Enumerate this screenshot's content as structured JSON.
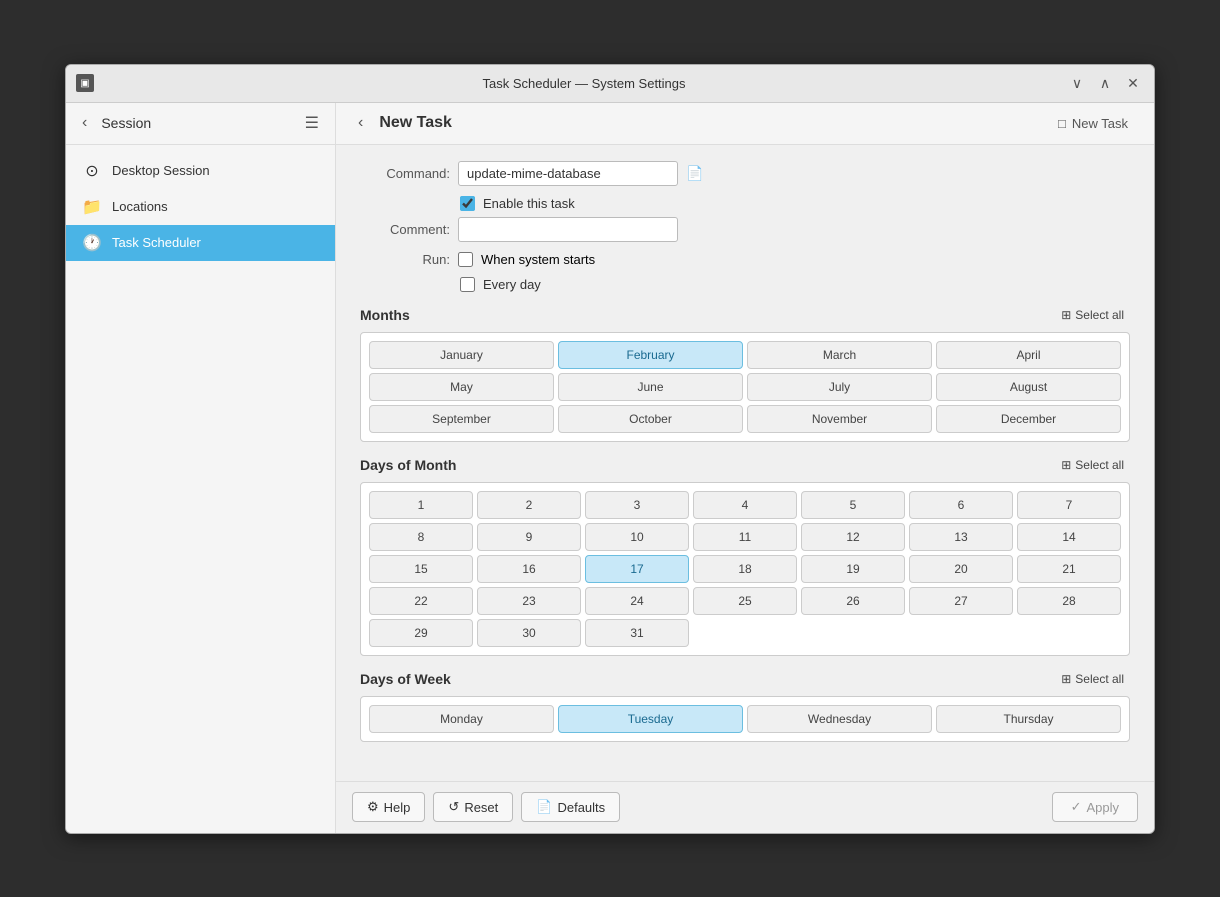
{
  "window": {
    "title": "Task Scheduler — System Settings",
    "icon": "▣",
    "controls": {
      "minimize": "∨",
      "maximize": "∧",
      "close": "✕"
    }
  },
  "sidebar": {
    "session_label": "Session",
    "items": [
      {
        "id": "desktop-session",
        "label": "Desktop Session",
        "icon": "⊙",
        "active": false
      },
      {
        "id": "locations",
        "label": "Locations",
        "icon": "📁",
        "active": false
      },
      {
        "id": "task-scheduler",
        "label": "Task Scheduler",
        "icon": "🕐",
        "active": true
      }
    ]
  },
  "header": {
    "back_label": "‹",
    "title": "New Task",
    "new_task_label": "New Task",
    "new_task_icon": "□"
  },
  "form": {
    "command_label": "Command:",
    "command_value": "update-mime-database",
    "command_icon": "📄",
    "enable_label": "Enable this task",
    "comment_label": "Comment:",
    "comment_value": "",
    "run_label": "Run:",
    "run_options": [
      {
        "id": "when-system-starts",
        "label": "When system starts"
      },
      {
        "id": "every-day",
        "label": "Every day"
      }
    ]
  },
  "months": {
    "title": "Months",
    "select_all_label": "Select all",
    "items": [
      {
        "label": "January",
        "selected": false
      },
      {
        "label": "February",
        "selected": true
      },
      {
        "label": "March",
        "selected": false
      },
      {
        "label": "April",
        "selected": false
      },
      {
        "label": "May",
        "selected": false
      },
      {
        "label": "June",
        "selected": false
      },
      {
        "label": "July",
        "selected": false
      },
      {
        "label": "August",
        "selected": false
      },
      {
        "label": "September",
        "selected": false
      },
      {
        "label": "October",
        "selected": false
      },
      {
        "label": "November",
        "selected": false
      },
      {
        "label": "December",
        "selected": false
      }
    ]
  },
  "days_of_month": {
    "title": "Days of Month",
    "select_all_label": "Select all",
    "items": [
      "1",
      "2",
      "3",
      "4",
      "5",
      "6",
      "7",
      "8",
      "9",
      "10",
      "11",
      "12",
      "13",
      "14",
      "15",
      "16",
      "17",
      "18",
      "19",
      "20",
      "21",
      "22",
      "23",
      "24",
      "25",
      "26",
      "27",
      "28",
      "29",
      "30",
      "31"
    ],
    "selected": [
      "17"
    ]
  },
  "days_of_week": {
    "title": "Days of Week",
    "select_all_label": "Select all",
    "items": [
      {
        "label": "Monday",
        "selected": false
      },
      {
        "label": "Tuesday",
        "selected": true
      },
      {
        "label": "Wednesday",
        "selected": false
      },
      {
        "label": "Thursday",
        "selected": false
      }
    ]
  },
  "toolbar": {
    "help_label": "Help",
    "help_icon": "⚙",
    "reset_label": "Reset",
    "reset_icon": "↺",
    "defaults_label": "Defaults",
    "defaults_icon": "📄",
    "apply_label": "Apply",
    "apply_icon": "✓"
  }
}
